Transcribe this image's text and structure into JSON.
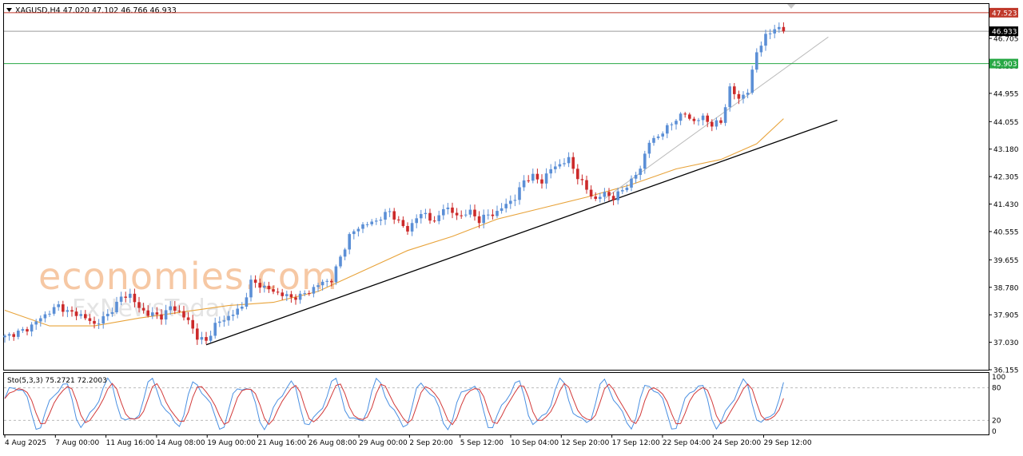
{
  "chart_data": {
    "type": "candlestick",
    "symbol_header": "XAGUSD,H4  47.020 47.102 46.766 46.933",
    "price_axis": {
      "range": [
        36.155,
        47.8
      ],
      "ticks": [
        "36.155",
        "37.030",
        "37.905",
        "38.780",
        "39.655",
        "40.555",
        "41.430",
        "42.305",
        "43.180",
        "44.055",
        "44.955",
        "45.830",
        "46.705"
      ]
    },
    "time_axis": {
      "labels": [
        "4 Aug 2025",
        "7 Aug 00:00",
        "11 Aug 16:00",
        "14 Aug 08:00",
        "19 Aug 00:00",
        "21 Aug 16:00",
        "26 Aug 08:00",
        "29 Aug 00:00",
        "2 Sep 20:00",
        "5 Sep 12:00",
        "10 Sep 04:00",
        "12 Sep 20:00",
        "17 Sep 12:00",
        "22 Sep 04:00",
        "24 Sep 20:00",
        "29 Sep 12:00"
      ]
    },
    "horizontal_levels": [
      {
        "value": 47.523,
        "label": "47.523",
        "color": "#c0392b"
      },
      {
        "value": 46.933,
        "label": "46.933",
        "color": "#9a9a9a",
        "current": true
      },
      {
        "value": 45.903,
        "label": "45.903",
        "color": "#27a844"
      }
    ],
    "price_path": [
      [
        0,
        37.2
      ],
      [
        5,
        37.45
      ],
      [
        8,
        37.8
      ],
      [
        12,
        38.2
      ],
      [
        14,
        38.0
      ],
      [
        17,
        37.9
      ],
      [
        20,
        37.6
      ],
      [
        23,
        37.9
      ],
      [
        26,
        38.45
      ],
      [
        28,
        38.55
      ],
      [
        30,
        38.1
      ],
      [
        32,
        37.95
      ],
      [
        35,
        37.85
      ],
      [
        37,
        38.15
      ],
      [
        39,
        38.0
      ],
      [
        41,
        37.7
      ],
      [
        43,
        37.2
      ],
      [
        45,
        37.05
      ],
      [
        47,
        37.6
      ],
      [
        49,
        37.75
      ],
      [
        51,
        37.95
      ],
      [
        53,
        38.15
      ],
      [
        55,
        38.95
      ],
      [
        57,
        38.85
      ],
      [
        60,
        38.65
      ],
      [
        62,
        38.55
      ],
      [
        64,
        38.45
      ],
      [
        66,
        38.5
      ],
      [
        68,
        38.65
      ],
      [
        71,
        38.95
      ],
      [
        73,
        39.0
      ],
      [
        75,
        39.75
      ],
      [
        77,
        40.4
      ],
      [
        79,
        40.7
      ],
      [
        81,
        40.8
      ],
      [
        83,
        40.9
      ],
      [
        86,
        41.2
      ],
      [
        88,
        40.85
      ],
      [
        90,
        40.6
      ],
      [
        92,
        41.0
      ],
      [
        94,
        41.15
      ],
      [
        96,
        40.8
      ],
      [
        98,
        41.35
      ],
      [
        100,
        41.15
      ],
      [
        102,
        41.05
      ],
      [
        104,
        41.2
      ],
      [
        106,
        40.9
      ],
      [
        108,
        41.1
      ],
      [
        110,
        41.15
      ],
      [
        112,
        41.45
      ],
      [
        114,
        41.6
      ],
      [
        116,
        42.2
      ],
      [
        118,
        42.3
      ],
      [
        120,
        42.15
      ],
      [
        122,
        42.55
      ],
      [
        124,
        42.7
      ],
      [
        126,
        42.85
      ],
      [
        128,
        42.3
      ],
      [
        130,
        41.9
      ],
      [
        132,
        41.55
      ],
      [
        134,
        41.8
      ],
      [
        136,
        41.6
      ],
      [
        138,
        41.9
      ],
      [
        140,
        42.15
      ],
      [
        142,
        42.6
      ],
      [
        144,
        43.4
      ],
      [
        146,
        43.6
      ],
      [
        148,
        43.85
      ],
      [
        150,
        44.15
      ],
      [
        152,
        44.3
      ],
      [
        154,
        44.05
      ],
      [
        156,
        44.2
      ],
      [
        158,
        43.95
      ],
      [
        160,
        44.05
      ],
      [
        162,
        45.1
      ],
      [
        164,
        44.8
      ],
      [
        166,
        45.0
      ],
      [
        168,
        46.3
      ],
      [
        170,
        46.75
      ],
      [
        172,
        47.05
      ],
      [
        174,
        46.95
      ]
    ],
    "moving_average": [
      [
        0,
        38.05
      ],
      [
        10,
        37.55
      ],
      [
        20,
        37.55
      ],
      [
        30,
        37.8
      ],
      [
        40,
        38.0
      ],
      [
        50,
        38.2
      ],
      [
        60,
        38.3
      ],
      [
        70,
        38.65
      ],
      [
        80,
        39.3
      ],
      [
        90,
        39.95
      ],
      [
        100,
        40.4
      ],
      [
        110,
        40.95
      ],
      [
        120,
        41.3
      ],
      [
        130,
        41.65
      ],
      [
        140,
        42.05
      ],
      [
        150,
        42.55
      ],
      [
        160,
        42.85
      ],
      [
        168,
        43.35
      ],
      [
        174,
        44.15
      ]
    ],
    "trendlines": [
      {
        "name": "support",
        "from": [
          45,
          36.95
        ],
        "to": [
          186,
          44.1
        ],
        "color": "#000000"
      },
      {
        "name": "channel",
        "from": [
          134,
          41.6
        ],
        "to": [
          184,
          46.75
        ],
        "color": "#bbbbbb"
      }
    ],
    "stochastic": {
      "header": "Sto(5,3,3) 75.2721 72.2003",
      "range": [
        0,
        100
      ],
      "levels": [
        20,
        80
      ],
      "tick_labels": [
        "100",
        "80",
        "20",
        "0"
      ]
    },
    "watermark": {
      "brand": "economies.com",
      "secondary": "FxNewsToday"
    }
  }
}
